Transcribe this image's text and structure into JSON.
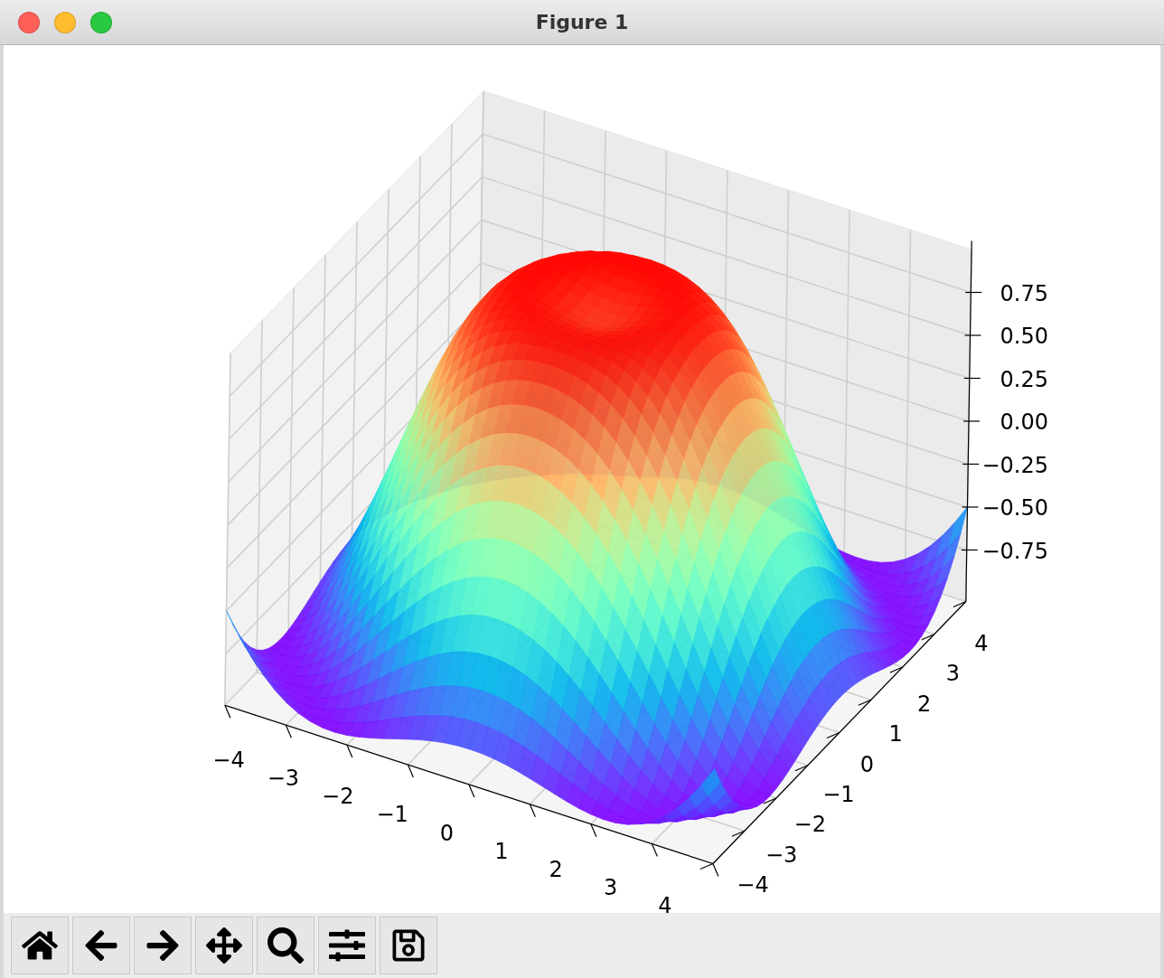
{
  "window": {
    "title": "Figure 1"
  },
  "plot": {
    "z_ticks": [
      "0.75",
      "0.50",
      "0.25",
      "0.00",
      "−0.25",
      "−0.50",
      "−0.75"
    ],
    "x_ticks": [
      "−4",
      "−3",
      "−2",
      "−1",
      "0",
      "1",
      "2",
      "3",
      "4"
    ],
    "y_ticks": [
      "−4",
      "−3",
      "−2",
      "−1",
      "0",
      "1",
      "2",
      "3",
      "4"
    ]
  }
}
